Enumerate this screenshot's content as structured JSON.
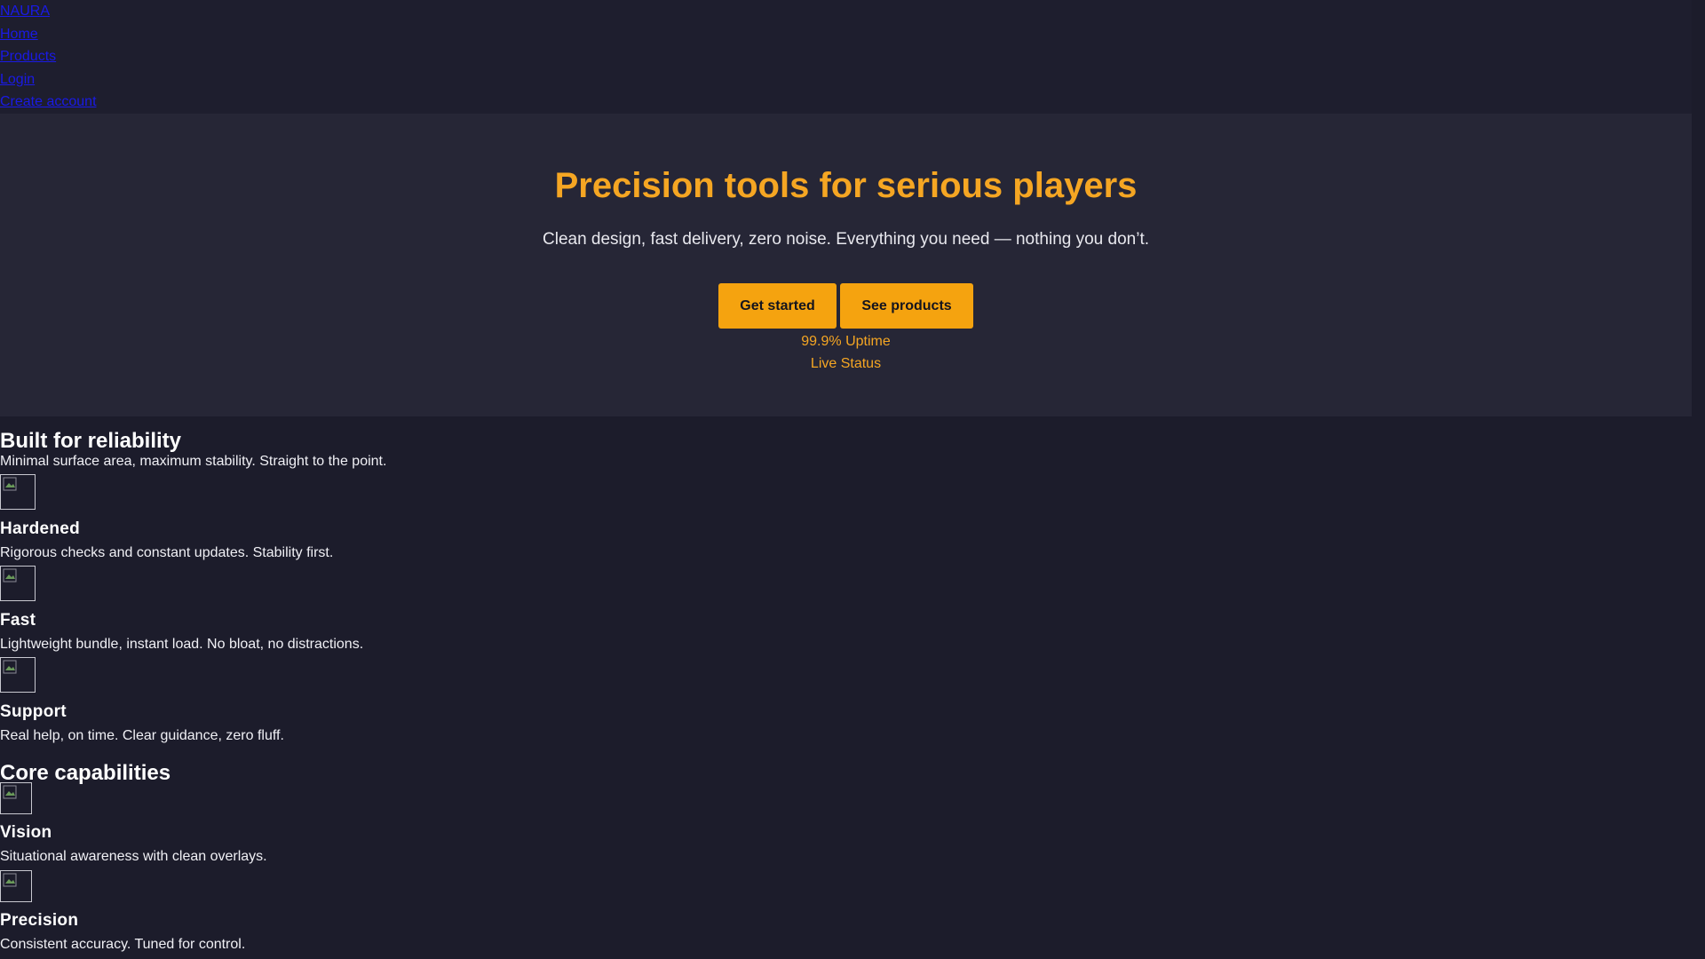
{
  "nav": {
    "brand": "NAURA",
    "links": [
      "Home",
      "Products",
      "Login",
      "Create account"
    ]
  },
  "hero": {
    "title": "Precision tools for serious players",
    "subtitle": "Clean design, fast delivery, zero noise. Everything you need — nothing you don’t.",
    "primary_button": "Get started",
    "secondary_button": "See products",
    "uptime": "99.9% Uptime",
    "status": "Live Status"
  },
  "reliability": {
    "heading": "Built for reliability",
    "intro": "Minimal surface area, maximum stability. Straight to the point.",
    "features": [
      {
        "title": "Hardened",
        "text": "Rigorous checks and constant updates. Stability first."
      },
      {
        "title": "Fast",
        "text": "Lightweight bundle, instant load. No bloat, no distractions."
      },
      {
        "title": "Support",
        "text": "Real help, on time. Clear guidance, zero fluff."
      }
    ]
  },
  "capabilities": {
    "heading": "Core capabilities",
    "items": [
      {
        "title": "Vision",
        "text": "Situational awareness with clean overlays."
      },
      {
        "title": "Precision",
        "text": "Consistent accuracy. Tuned for control."
      }
    ]
  },
  "colors": {
    "accent": "#f5a623",
    "button": "#f5a30f",
    "hero_bg": "#262636",
    "page_bg": "#1c1c2b",
    "link": "#1a1ae6"
  }
}
